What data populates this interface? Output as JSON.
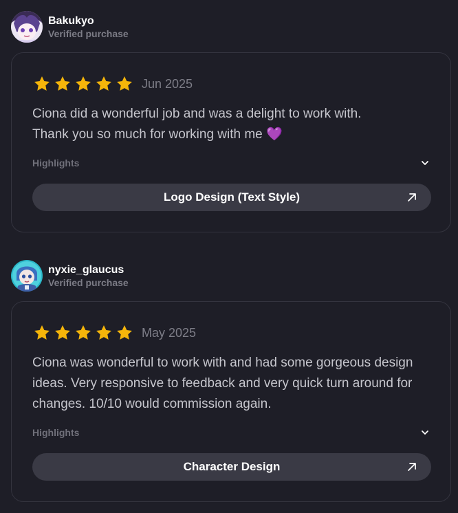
{
  "reviews": [
    {
      "reviewer": {
        "name": "Bakukyo",
        "verified": "Verified purchase"
      },
      "rating": 5,
      "date": "Jun 2025",
      "text_line1": "Ciona did a wonderful job and was a delight to work with.",
      "text_line2": "Thank you so much for working with me",
      "emoji": "💜",
      "highlights_label": "Highlights",
      "service": "Logo Design (Text Style)"
    },
    {
      "reviewer": {
        "name": "nyxie_glaucus",
        "verified": "Verified purchase"
      },
      "rating": 5,
      "date": "May 2025",
      "text": "Ciona was wonderful to work with and had some gorgeous design ideas. Very responsive to feedback and very quick turn around for changes. 10/10 would commission again.",
      "highlights_label": "Highlights",
      "service": "Character Design"
    }
  ],
  "colors": {
    "background": "#1e1e27",
    "card_border": "#34343f",
    "star": "#f5b50a",
    "button": "#3a3a45",
    "muted_text": "#7c7c86",
    "body_text": "#c6c6cd"
  }
}
